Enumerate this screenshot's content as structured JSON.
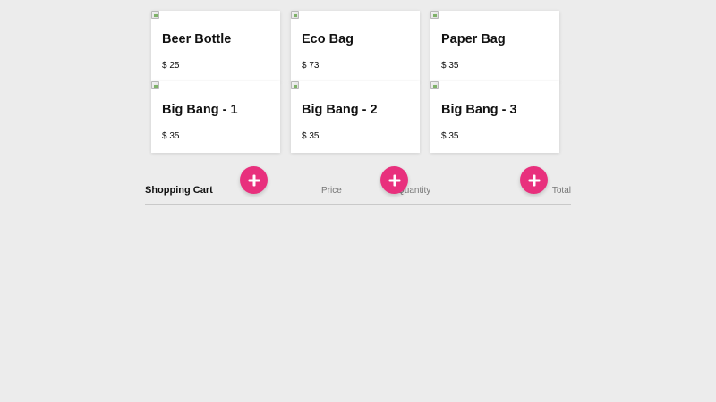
{
  "products": [
    {
      "name": "Beer Bottle",
      "price": "$ 25"
    },
    {
      "name": "Eco Bag",
      "price": "$ 73"
    },
    {
      "name": "Paper Bag",
      "price": "$ 35"
    },
    {
      "name": "Big Bang - 1",
      "price": "$ 35"
    },
    {
      "name": "Big Bang - 2",
      "price": "$ 35"
    },
    {
      "name": "Big Bang - 3",
      "price": "$ 35"
    }
  ],
  "cart": {
    "title": "Shopping Cart",
    "columns": {
      "price": "Price",
      "quantity": "Quantity",
      "total": "Total"
    }
  },
  "colors": {
    "background": "#ececec",
    "accent": "#e8307d",
    "card": "#ffffff"
  },
  "icons": {
    "add": "plus-icon",
    "product_image": "broken-image-icon"
  }
}
